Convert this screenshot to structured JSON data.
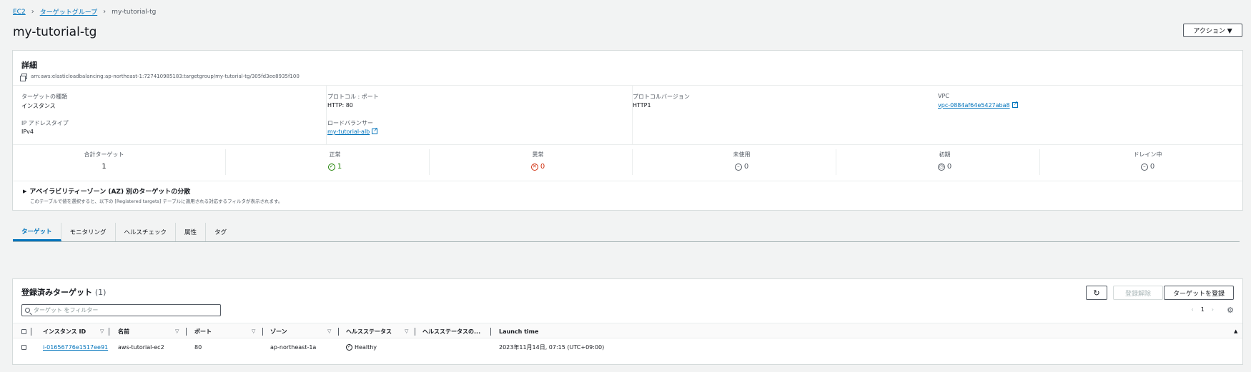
{
  "breadcrumb": {
    "root": "EC2",
    "parent": "ターゲットグループ",
    "current": "my-tutorial-tg"
  },
  "page_title": "my-tutorial-tg",
  "actions_button": "アクション ▼",
  "details": {
    "heading": "詳細",
    "arn": "arn:aws:elasticloadbalancing:ap-northeast-1:727410985183:targetgroup/my-tutorial-tg/305fd3ee8935f100",
    "target_type_label": "ターゲットの種類",
    "target_type_value": "インスタンス",
    "ip_type_label": "IP アドレスタイプ",
    "ip_type_value": "IPv4",
    "protocol_label": "プロトコル : ポート",
    "protocol_value": "HTTP: 80",
    "lb_label": "ロードバランサー",
    "lb_value": "my-tutorial-alb",
    "protocol_version_label": "プロトコルバージョン",
    "protocol_version_value": "HTTP1",
    "vpc_label": "VPC",
    "vpc_value": "vpc-0884af64e5427aba8"
  },
  "stats": [
    {
      "label": "合計ターゲット",
      "value": "1"
    },
    {
      "label": "正常",
      "value": "1"
    },
    {
      "label": "異常",
      "value": "0"
    },
    {
      "label": "未使用",
      "value": "0"
    },
    {
      "label": "初期",
      "value": "0"
    },
    {
      "label": "ドレイン中",
      "value": "0"
    }
  ],
  "az": {
    "title": "アベイラビリティーゾーン (AZ) 別のターゲットの分散",
    "description": "このテーブルで値を選択すると、以下の [Registered targets] テーブルに適用される対応するフィルタが表示されます。"
  },
  "tabs": [
    "ターゲット",
    "モニタリング",
    "ヘルスチェック",
    "属性",
    "タグ"
  ],
  "targets": {
    "title": "登録済みターゲット",
    "count": "(1)",
    "deregister_button": "登録解除",
    "register_button": "ターゲットを登録",
    "search_placeholder": "ターゲット をフィルター",
    "page": "1",
    "columns": [
      "インスタンス ID",
      "名前",
      "ポート",
      "ゾーン",
      "ヘルスステータス",
      "ヘルスステータスの...",
      "Launch time"
    ],
    "rows": [
      {
        "instance_id": "i-01656776e1517ee91",
        "name": "aws-tutorial-ec2",
        "port": "80",
        "zone": "ap-northeast-1a",
        "health": "Healthy",
        "health_detail": "",
        "launch_time": "2023年11月14日, 07:15 (UTC+09:00)"
      }
    ]
  },
  "colors": {
    "link": "#0073bb",
    "ok": "#1d8102",
    "error": "#d13212",
    "text": "#16191f",
    "muted": "#545b64"
  }
}
